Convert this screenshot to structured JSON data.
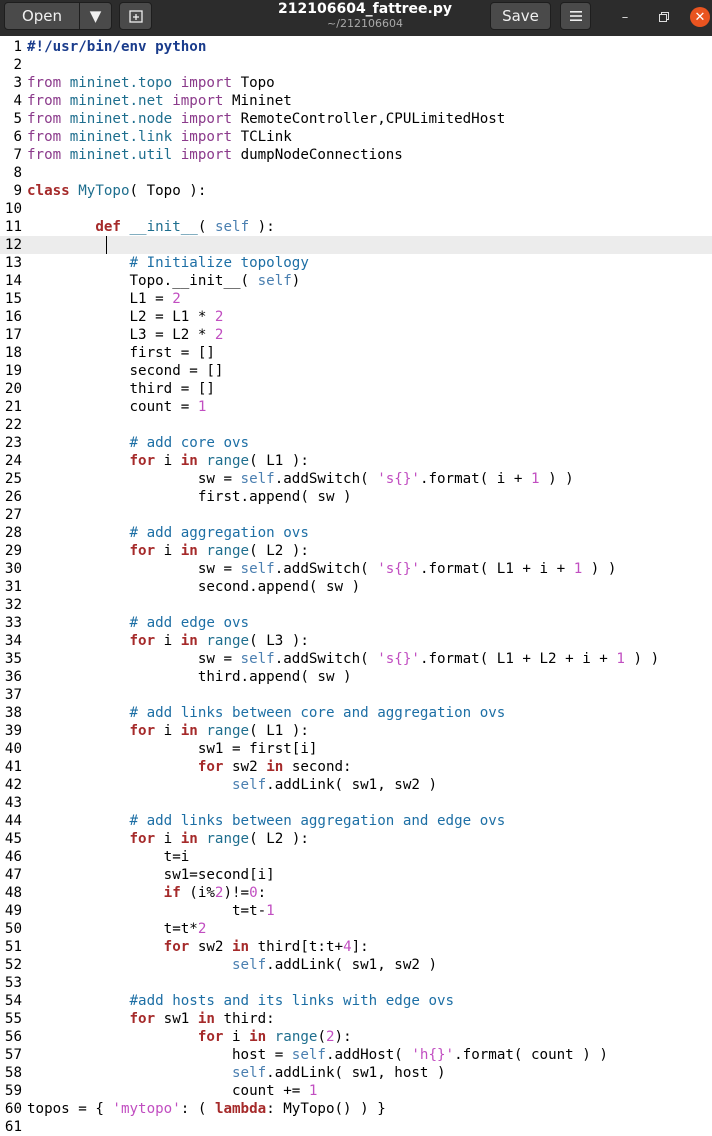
{
  "titlebar": {
    "open_label": "Open",
    "file_name": "212106604_fattree.py",
    "file_path": "~/212106604",
    "save_label": "Save"
  },
  "editor": {
    "current_line": 12,
    "lines": [
      [
        [
          "shebang",
          "#!/usr/bin/env python"
        ]
      ],
      [],
      [
        [
          "imp",
          "from "
        ],
        [
          "mod",
          "mininet.topo "
        ],
        [
          "imp",
          "import "
        ],
        [
          "",
          "Topo"
        ]
      ],
      [
        [
          "imp",
          "from "
        ],
        [
          "mod",
          "mininet.net "
        ],
        [
          "imp",
          "import "
        ],
        [
          "",
          "Mininet"
        ]
      ],
      [
        [
          "imp",
          "from "
        ],
        [
          "mod",
          "mininet.node "
        ],
        [
          "imp",
          "import "
        ],
        [
          "",
          "RemoteController,CPULimitedHost"
        ]
      ],
      [
        [
          "imp",
          "from "
        ],
        [
          "mod",
          "mininet.link "
        ],
        [
          "imp",
          "import "
        ],
        [
          "",
          "TCLink"
        ]
      ],
      [
        [
          "imp",
          "from "
        ],
        [
          "mod",
          "mininet.util "
        ],
        [
          "imp",
          "import "
        ],
        [
          "",
          "dumpNodeConnections"
        ]
      ],
      [],
      [
        [
          "kw",
          "class "
        ],
        [
          "fn",
          "MyTopo"
        ],
        [
          "",
          "( Topo ):"
        ]
      ],
      [],
      [
        [
          "",
          "        "
        ],
        [
          "kw",
          "def "
        ],
        [
          "fn",
          "__init__"
        ],
        [
          "",
          "( "
        ],
        [
          "self",
          "self"
        ],
        [
          "",
          " ):"
        ]
      ],
      [
        [
          "",
          "         "
        ]
      ],
      [
        [
          "",
          "            "
        ],
        [
          "cm",
          "# Initialize topology"
        ]
      ],
      [
        [
          "",
          "            Topo.__init__( "
        ],
        [
          "self",
          "self"
        ],
        [
          "",
          ")"
        ]
      ],
      [
        [
          "",
          "            L1 = "
        ],
        [
          "num",
          "2"
        ]
      ],
      [
        [
          "",
          "            L2 = L1 * "
        ],
        [
          "num",
          "2"
        ]
      ],
      [
        [
          "",
          "            L3 = L2 * "
        ],
        [
          "num",
          "2"
        ]
      ],
      [
        [
          "",
          "            first = []"
        ]
      ],
      [
        [
          "",
          "            second = []"
        ]
      ],
      [
        [
          "",
          "            third = []"
        ]
      ],
      [
        [
          "",
          "            count = "
        ],
        [
          "num",
          "1"
        ]
      ],
      [],
      [
        [
          "",
          "            "
        ],
        [
          "cm",
          "# add core ovs"
        ]
      ],
      [
        [
          "",
          "            "
        ],
        [
          "kw",
          "for "
        ],
        [
          "",
          "i "
        ],
        [
          "kw",
          "in "
        ],
        [
          "fn",
          "range"
        ],
        [
          "",
          "( L1 ):"
        ]
      ],
      [
        [
          "",
          "                    sw = "
        ],
        [
          "self",
          "self"
        ],
        [
          "",
          ".addSwitch( "
        ],
        [
          "str",
          "'s{}'"
        ],
        [
          "",
          ".format( i + "
        ],
        [
          "num",
          "1"
        ],
        [
          "",
          " ) )"
        ]
      ],
      [
        [
          "",
          "                    first.append( sw )"
        ]
      ],
      [],
      [
        [
          "",
          "            "
        ],
        [
          "cm",
          "# add aggregation ovs"
        ]
      ],
      [
        [
          "",
          "            "
        ],
        [
          "kw",
          "for "
        ],
        [
          "",
          "i "
        ],
        [
          "kw",
          "in "
        ],
        [
          "fn",
          "range"
        ],
        [
          "",
          "( L2 ):"
        ]
      ],
      [
        [
          "",
          "                    sw = "
        ],
        [
          "self",
          "self"
        ],
        [
          "",
          ".addSwitch( "
        ],
        [
          "str",
          "'s{}'"
        ],
        [
          "",
          ".format( L1 + i + "
        ],
        [
          "num",
          "1"
        ],
        [
          "",
          " ) )"
        ]
      ],
      [
        [
          "",
          "                    second.append( sw )"
        ]
      ],
      [],
      [
        [
          "",
          "            "
        ],
        [
          "cm",
          "# add edge ovs"
        ]
      ],
      [
        [
          "",
          "            "
        ],
        [
          "kw",
          "for "
        ],
        [
          "",
          "i "
        ],
        [
          "kw",
          "in "
        ],
        [
          "fn",
          "range"
        ],
        [
          "",
          "( L3 ):"
        ]
      ],
      [
        [
          "",
          "                    sw = "
        ],
        [
          "self",
          "self"
        ],
        [
          "",
          ".addSwitch( "
        ],
        [
          "str",
          "'s{}'"
        ],
        [
          "",
          ".format( L1 + L2 + i + "
        ],
        [
          "num",
          "1"
        ],
        [
          "",
          " ) )"
        ]
      ],
      [
        [
          "",
          "                    third.append( sw )"
        ]
      ],
      [],
      [
        [
          "",
          "            "
        ],
        [
          "cm",
          "# add links between core and aggregation ovs"
        ]
      ],
      [
        [
          "",
          "            "
        ],
        [
          "kw",
          "for "
        ],
        [
          "",
          "i "
        ],
        [
          "kw",
          "in "
        ],
        [
          "fn",
          "range"
        ],
        [
          "",
          "( L1 ):"
        ]
      ],
      [
        [
          "",
          "                    sw1 = first[i]"
        ]
      ],
      [
        [
          "",
          "                    "
        ],
        [
          "kw",
          "for "
        ],
        [
          "",
          "sw2 "
        ],
        [
          "kw",
          "in "
        ],
        [
          "",
          "second:"
        ]
      ],
      [
        [
          "",
          "                        "
        ],
        [
          "self",
          "self"
        ],
        [
          "",
          ".addLink( sw1, sw2 )"
        ]
      ],
      [],
      [
        [
          "",
          "            "
        ],
        [
          "cm",
          "# add links between aggregation and edge ovs"
        ]
      ],
      [
        [
          "",
          "            "
        ],
        [
          "kw",
          "for "
        ],
        [
          "",
          "i "
        ],
        [
          "kw",
          "in "
        ],
        [
          "fn",
          "range"
        ],
        [
          "",
          "( L2 ):"
        ]
      ],
      [
        [
          "",
          "                t=i"
        ]
      ],
      [
        [
          "",
          "                sw1=second[i]"
        ]
      ],
      [
        [
          "",
          "                "
        ],
        [
          "kw",
          "if "
        ],
        [
          "",
          "(i%"
        ],
        [
          "num",
          "2"
        ],
        [
          "",
          ")!="
        ],
        [
          "num",
          "0"
        ],
        [
          "",
          ":"
        ]
      ],
      [
        [
          "",
          "                        t=t-"
        ],
        [
          "num",
          "1"
        ]
      ],
      [
        [
          "",
          "                t=t*"
        ],
        [
          "num",
          "2"
        ]
      ],
      [
        [
          "",
          "                "
        ],
        [
          "kw",
          "for "
        ],
        [
          "",
          "sw2 "
        ],
        [
          "kw",
          "in "
        ],
        [
          "",
          "third[t:t+"
        ],
        [
          "num",
          "4"
        ],
        [
          "",
          "]:"
        ]
      ],
      [
        [
          "",
          "                        "
        ],
        [
          "self",
          "self"
        ],
        [
          "",
          ".addLink( sw1, sw2 )"
        ]
      ],
      [],
      [
        [
          "",
          "            "
        ],
        [
          "cm",
          "#add hosts and its links with edge ovs"
        ]
      ],
      [
        [
          "",
          "            "
        ],
        [
          "kw",
          "for "
        ],
        [
          "",
          "sw1 "
        ],
        [
          "kw",
          "in "
        ],
        [
          "",
          "third:"
        ]
      ],
      [
        [
          "",
          "                    "
        ],
        [
          "kw",
          "for "
        ],
        [
          "",
          "i "
        ],
        [
          "kw",
          "in "
        ],
        [
          "fn",
          "range"
        ],
        [
          "",
          "("
        ],
        [
          "num",
          "2"
        ],
        [
          "",
          "):"
        ]
      ],
      [
        [
          "",
          "                        host = "
        ],
        [
          "self",
          "self"
        ],
        [
          "",
          ".addHost( "
        ],
        [
          "str",
          "'h{}'"
        ],
        [
          "",
          ".format( count ) )"
        ]
      ],
      [
        [
          "",
          "                        "
        ],
        [
          "self",
          "self"
        ],
        [
          "",
          ".addLink( sw1, host )"
        ]
      ],
      [
        [
          "",
          "                        count += "
        ],
        [
          "num",
          "1"
        ]
      ],
      [
        [
          "",
          "topos = { "
        ],
        [
          "str",
          "'mytopo'"
        ],
        [
          "",
          ": ( "
        ],
        [
          "kw",
          "lambda"
        ],
        [
          "",
          ": MyTopo() ) }"
        ]
      ],
      []
    ]
  }
}
